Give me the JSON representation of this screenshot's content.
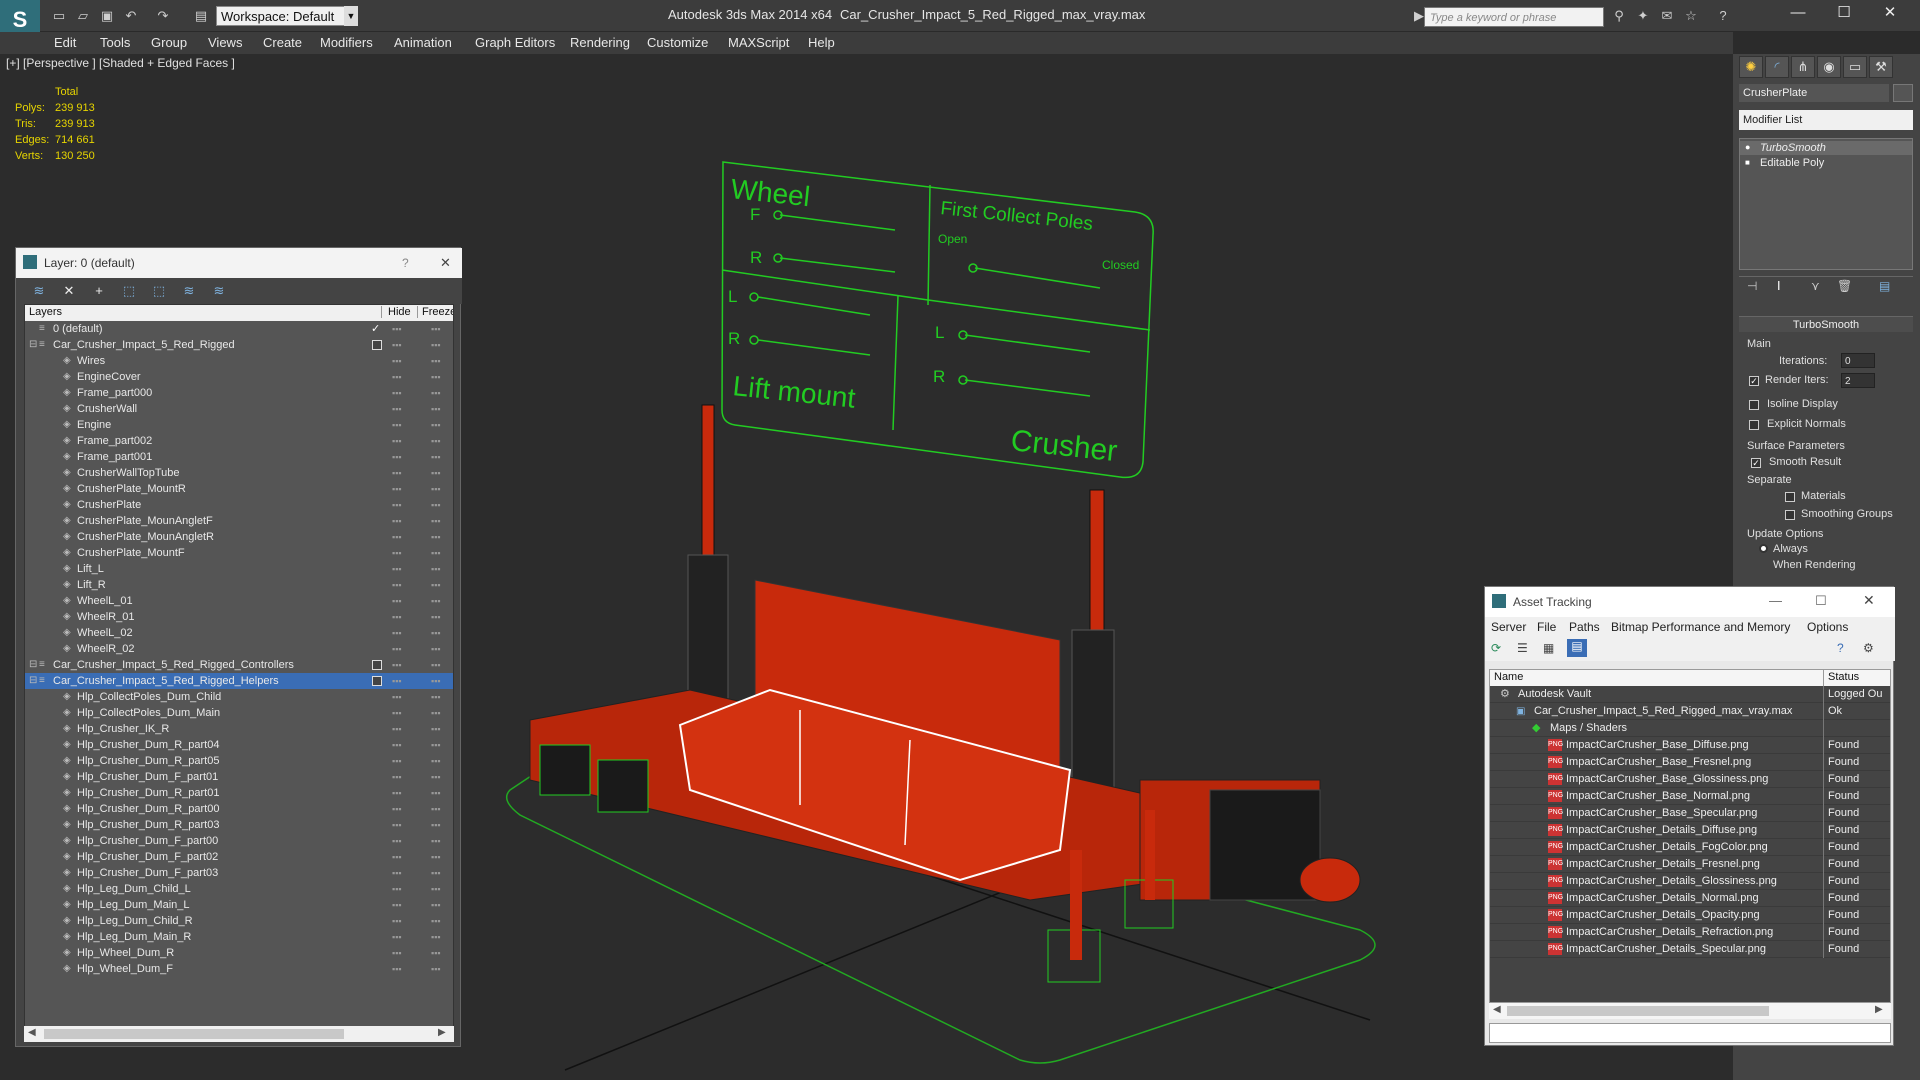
{
  "titlebar": {
    "workspace_label": "Workspace: Default",
    "app_title": "Autodesk 3ds Max  2014 x64",
    "file_title": "Car_Crusher_Impact_5_Red_Rigged_max_vray.max",
    "search_placeholder": "Type a keyword or phrase"
  },
  "menus": [
    "Edit",
    "Tools",
    "Group",
    "Views",
    "Create",
    "Modifiers",
    "Animation",
    "Graph Editors",
    "Rendering",
    "Customize",
    "MAXScript",
    "Help"
  ],
  "viewport": {
    "label": "[+] [Perspective ] [Shaded + Edged Faces ]",
    "stats": {
      "total_label": "Total",
      "polys_label": "Polys:",
      "polys": "239 913",
      "tris_label": "Tris:",
      "tris": "239 913",
      "edges_label": "Edges:",
      "edges": "714 661",
      "verts_label": "Verts:",
      "verts": "130 250"
    },
    "control_board": {
      "wheel": "Wheel",
      "f": "F",
      "r": "R",
      "l": "L",
      "r2": "R",
      "lift_mount": "Lift mount",
      "first_collect_poles": "First Collect Poles",
      "open": "Open",
      "closed": "Closed",
      "l2": "L",
      "r3": "R",
      "crusher": "Crusher"
    }
  },
  "layer_panel": {
    "title": "Layer: 0 (default)",
    "help": "?",
    "close": "✕",
    "col_layers": "Layers",
    "col_hide": "Hide",
    "col_freeze": "Freeze",
    "rows": [
      {
        "name": "0 (default)",
        "level": 0,
        "type": "layer",
        "check": true
      },
      {
        "name": "Car_Crusher_Impact_5_Red_Rigged",
        "level": 0,
        "type": "layer",
        "box": true
      },
      {
        "name": "Wires",
        "level": 1
      },
      {
        "name": "EngineCover",
        "level": 1
      },
      {
        "name": "Frame_part000",
        "level": 1
      },
      {
        "name": "CrusherWall",
        "level": 1
      },
      {
        "name": "Engine",
        "level": 1
      },
      {
        "name": "Frame_part002",
        "level": 1
      },
      {
        "name": "Frame_part001",
        "level": 1
      },
      {
        "name": "CrusherWallTopTube",
        "level": 1
      },
      {
        "name": "CrusherPlate_MountR",
        "level": 1
      },
      {
        "name": "CrusherPlate",
        "level": 1
      },
      {
        "name": "CrusherPlate_MounAngletF",
        "level": 1
      },
      {
        "name": "CrusherPlate_MounAngletR",
        "level": 1
      },
      {
        "name": "CrusherPlate_MountF",
        "level": 1
      },
      {
        "name": "Lift_L",
        "level": 1
      },
      {
        "name": "Lift_R",
        "level": 1
      },
      {
        "name": "WheelL_01",
        "level": 1
      },
      {
        "name": "WheelR_01",
        "level": 1
      },
      {
        "name": "WheelL_02",
        "level": 1
      },
      {
        "name": "WheelR_02",
        "level": 1
      },
      {
        "name": "Car_Crusher_Impact_5_Red_Rigged_Controllers",
        "level": 0,
        "type": "layer",
        "box": true
      },
      {
        "name": "Car_Crusher_Impact_5_Red_Rigged_Helpers",
        "level": 0,
        "type": "layer",
        "box": true,
        "selected": true
      },
      {
        "name": "Hlp_CollectPoles_Dum_Child",
        "level": 1
      },
      {
        "name": "Hlp_CollectPoles_Dum_Main",
        "level": 1
      },
      {
        "name": "Hlp_Crusher_IK_R",
        "level": 1
      },
      {
        "name": "Hlp_Crusher_Dum_R_part04",
        "level": 1
      },
      {
        "name": "Hlp_Crusher_Dum_R_part05",
        "level": 1
      },
      {
        "name": "Hlp_Crusher_Dum_F_part01",
        "level": 1
      },
      {
        "name": "Hlp_Crusher_Dum_R_part01",
        "level": 1
      },
      {
        "name": "Hlp_Crusher_Dum_R_part00",
        "level": 1
      },
      {
        "name": "Hlp_Crusher_Dum_R_part03",
        "level": 1
      },
      {
        "name": "Hlp_Crusher_Dum_F_part00",
        "level": 1
      },
      {
        "name": "Hlp_Crusher_Dum_F_part02",
        "level": 1
      },
      {
        "name": "Hlp_Crusher_Dum_F_part03",
        "level": 1
      },
      {
        "name": "Hlp_Leg_Dum_Child_L",
        "level": 1
      },
      {
        "name": "Hlp_Leg_Dum_Main_L",
        "level": 1
      },
      {
        "name": "Hlp_Leg_Dum_Child_R",
        "level": 1
      },
      {
        "name": "Hlp_Leg_Dum_Main_R",
        "level": 1
      },
      {
        "name": "Hlp_Wheel_Dum_R",
        "level": 1
      },
      {
        "name": "Hlp_Wheel_Dum_F",
        "level": 1
      }
    ]
  },
  "command_panel": {
    "object_name": "CrusherPlate",
    "modifier_list": "Modifier List",
    "stack": [
      "TurboSmooth",
      "Editable Poly"
    ],
    "rollout_title": "TurboSmooth",
    "main_label": "Main",
    "iterations_label": "Iterations:",
    "iterations": "0",
    "render_iters_label": "Render Iters:",
    "render_iters": "2",
    "isoline_label": "Isoline Display",
    "explicit_normals_label": "Explicit Normals",
    "surface_params_label": "Surface Parameters",
    "smooth_result_label": "Smooth Result",
    "separate_label": "Separate",
    "materials_label": "Materials",
    "smoothing_groups_label": "Smoothing Groups",
    "update_options_label": "Update Options",
    "always_label": "Always",
    "when_rendering_label": "When Rendering"
  },
  "asset_tracking": {
    "title": "Asset Tracking",
    "menu": [
      "Server",
      "File",
      "Paths",
      "Bitmap Performance and Memory",
      "Options"
    ],
    "col_name": "Name",
    "col_status": "Status",
    "rows": [
      {
        "name": "Autodesk Vault",
        "status": "Logged Ou",
        "level": 0,
        "icon": "vault"
      },
      {
        "name": "Car_Crusher_Impact_5_Red_Rigged_max_vray.max",
        "status": "Ok",
        "level": 1,
        "icon": "max"
      },
      {
        "name": "Maps / Shaders",
        "status": "",
        "level": 2,
        "icon": "folder"
      },
      {
        "name": "ImpactCarCrusher_Base_Diffuse.png",
        "status": "Found",
        "level": 3,
        "icon": "png"
      },
      {
        "name": "ImpactCarCrusher_Base_Fresnel.png",
        "status": "Found",
        "level": 3,
        "icon": "png"
      },
      {
        "name": "ImpactCarCrusher_Base_Glossiness.png",
        "status": "Found",
        "level": 3,
        "icon": "png"
      },
      {
        "name": "ImpactCarCrusher_Base_Normal.png",
        "status": "Found",
        "level": 3,
        "icon": "png"
      },
      {
        "name": "ImpactCarCrusher_Base_Specular.png",
        "status": "Found",
        "level": 3,
        "icon": "png"
      },
      {
        "name": "ImpactCarCrusher_Details_Diffuse.png",
        "status": "Found",
        "level": 3,
        "icon": "png"
      },
      {
        "name": "ImpactCarCrusher_Details_FogColor.png",
        "status": "Found",
        "level": 3,
        "icon": "png"
      },
      {
        "name": "ImpactCarCrusher_Details_Fresnel.png",
        "status": "Found",
        "level": 3,
        "icon": "png"
      },
      {
        "name": "ImpactCarCrusher_Details_Glossiness.png",
        "status": "Found",
        "level": 3,
        "icon": "png"
      },
      {
        "name": "ImpactCarCrusher_Details_Normal.png",
        "status": "Found",
        "level": 3,
        "icon": "png"
      },
      {
        "name": "ImpactCarCrusher_Details_Opacity.png",
        "status": "Found",
        "level": 3,
        "icon": "png"
      },
      {
        "name": "ImpactCarCrusher_Details_Refraction.png",
        "status": "Found",
        "level": 3,
        "icon": "png"
      },
      {
        "name": "ImpactCarCrusher_Details_Specular.png",
        "status": "Found",
        "level": 3,
        "icon": "png"
      }
    ]
  },
  "colors": {
    "accent": "#3a6db5",
    "stat_text": "#e6d400",
    "wire_green": "#22cc22",
    "model_red": "#c82a0c"
  }
}
